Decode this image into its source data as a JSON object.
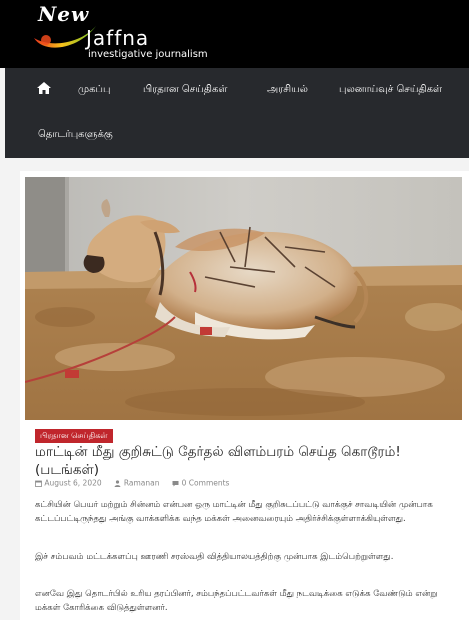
{
  "site": {
    "logo_new": "New",
    "logo_name": "Jaffna",
    "logo_tagline": "investigative journalism"
  },
  "nav": {
    "items": [
      {
        "label": "முகப்பு"
      },
      {
        "label": "பிரதான செய்திகள்"
      },
      {
        "label": "அரசியல்"
      },
      {
        "label": "புலனாய்வுச் செய்திகள்"
      },
      {
        "label": "தொடர்புகளுக்கு"
      }
    ]
  },
  "article": {
    "category": "பிரதான செய்திகள்",
    "title": "மாட்டின் மீது குறிசுட்டு தேர்தல் விளம்பரம் செய்த கொடூரம்! (படங்கள்)",
    "date": "August 6, 2020",
    "author": "Ramanan",
    "comments": "0 Comments",
    "paragraphs": [
      "கட்சியின் பெயர் மற்றும் சின்னம் என்பன ஒரு மாட்டின் மீது குறிசுடப்பட்டு வாக்குச் சாவடியின் முன்பாக கட்டப்பட்டிருந்தது அங்கு வாக்களிக்க வந்த மக்கள் அனைவரையும் அதிர்ச்சிக்குள்ளாக்கியுள்ளது.",
      "இச் சம்பவம் மட்டக்களப்பு ஊரணி சரஸ்வதி வித்தியாலயத்திற்கு முன்பாக இடம்பெற்றுள்ளது.",
      "எனவே இது தொடர்பில் உரிய தரப்பினர், சம்பந்தப்பட்டவர்கள் மீது நடவடிக்கை எடுக்க வேண்டும் என்று மக்கள் கோரிக்கை விடுத்துள்ளனர்."
    ]
  },
  "colors": {
    "badge": "#c0262c",
    "nav_bg": "#27292d",
    "header_bg": "#000000"
  }
}
